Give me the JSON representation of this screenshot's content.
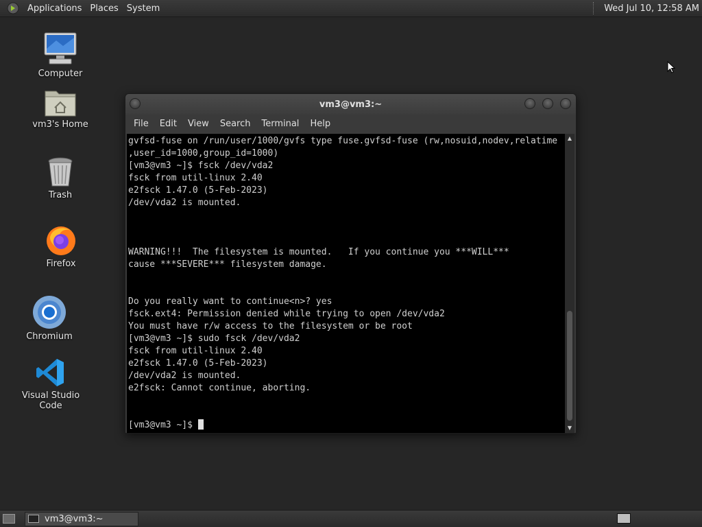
{
  "top_panel": {
    "menus": [
      "Applications",
      "Places",
      "System"
    ],
    "clock": "Wed Jul 10, 12:58 AM"
  },
  "desktop": {
    "icons": [
      {
        "label": "Computer",
        "icon": "computer-icon"
      },
      {
        "label": "vm3's Home",
        "icon": "home-folder-icon"
      },
      {
        "label": "Trash",
        "icon": "trash-icon"
      },
      {
        "label": "Firefox",
        "icon": "firefox-icon"
      },
      {
        "label": "Chromium",
        "icon": "chromium-icon"
      },
      {
        "label": "Visual Studio Code",
        "icon": "vscode-icon"
      }
    ]
  },
  "window": {
    "title": "vm3@vm3:~",
    "menu": [
      "File",
      "Edit",
      "View",
      "Search",
      "Terminal",
      "Help"
    ],
    "terminal_lines": [
      "gvfsd-fuse on /run/user/1000/gvfs type fuse.gvfsd-fuse (rw,nosuid,nodev,relatime",
      ",user_id=1000,group_id=1000)",
      "[vm3@vm3 ~]$ fsck /dev/vda2",
      "fsck from util-linux 2.40",
      "e2fsck 1.47.0 (5-Feb-2023)",
      "/dev/vda2 is mounted.",
      "",
      "",
      "",
      "WARNING!!!  The filesystem is mounted.   If you continue you ***WILL***",
      "cause ***SEVERE*** filesystem damage.",
      "",
      "",
      "Do you really want to continue<n>? yes",
      "fsck.ext4: Permission denied while trying to open /dev/vda2",
      "You must have r/w access to the filesystem or be root",
      "[vm3@vm3 ~]$ sudo fsck /dev/vda2",
      "fsck from util-linux 2.40",
      "e2fsck 1.47.0 (5-Feb-2023)",
      "/dev/vda2 is mounted.",
      "e2fsck: Cannot continue, aborting.",
      "",
      ""
    ],
    "prompt": "[vm3@vm3 ~]$ "
  },
  "bottom_panel": {
    "task_label": "vm3@vm3:~"
  }
}
